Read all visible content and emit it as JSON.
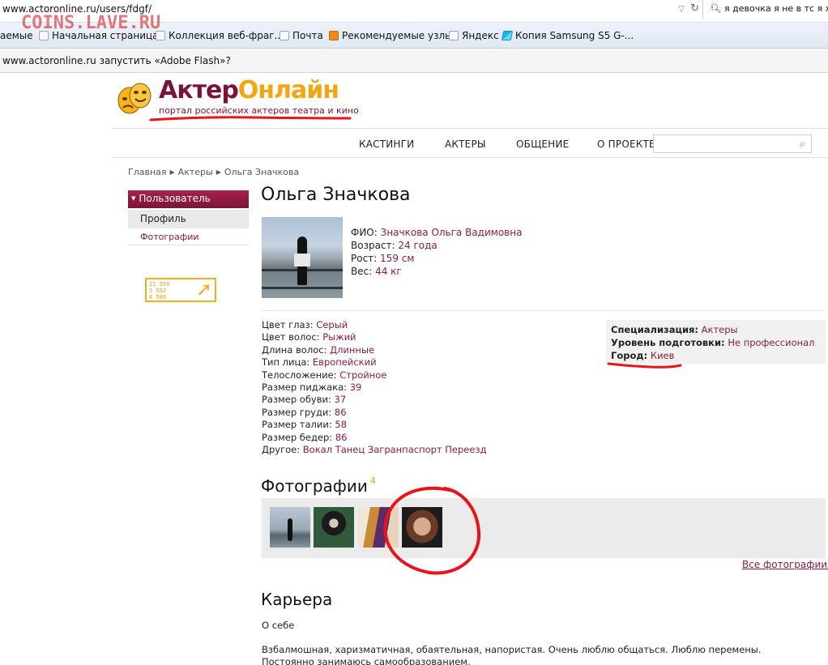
{
  "browser": {
    "url": "www.actoronline.ru/users/fdgf/",
    "search_value": "я девочка я не в тс я хочу",
    "bookmarks": [
      "аемые",
      "Начальная страница",
      "Коллекция веб-фраг...",
      "Почта",
      "Рекомендуемые узлы",
      "Яндекс",
      "Копия Samsung S5 G-..."
    ],
    "notification": "www.actoronline.ru запустить «Adobe Flash»?"
  },
  "watermark": "COINS.LAVE.RU",
  "site": {
    "brand_part1": "Актер",
    "brand_part2": "Онлайн",
    "tagline": "портал российских актеров театра и кино",
    "nav": [
      "КАСТИНГИ",
      "АКТЕРЫ",
      "ОБЩЕНИЕ",
      "О ПРОЕКТЕ"
    ],
    "breadcrumb": [
      "Главная",
      "Актеры",
      "Ольга Значкова"
    ]
  },
  "sidebar": {
    "header": "Пользователь",
    "items": [
      "Профиль",
      "Фотографии"
    ],
    "counter_lines": [
      "21 559",
      "5 552",
      "4 580"
    ]
  },
  "profile": {
    "name": "Ольга Значкова",
    "basic": [
      {
        "k": "ФИО:",
        "v": "Значкова Ольга Вадимовна"
      },
      {
        "k": "Возраст:",
        "v": "24 года"
      },
      {
        "k": "Рост:",
        "v": "159 см"
      },
      {
        "k": "Вес:",
        "v": "44 кг"
      }
    ],
    "attributes": [
      {
        "k": "Цвет глаз:",
        "v": "Серый"
      },
      {
        "k": "Цвет волос:",
        "v": "Рыжий"
      },
      {
        "k": "Длина волос:",
        "v": "Длинные"
      },
      {
        "k": "Тип лица:",
        "v": "Европейский"
      },
      {
        "k": "Телосложение:",
        "v": "Стройное"
      },
      {
        "k": "Размер пиджака:",
        "v": "39"
      },
      {
        "k": "Размер обуви:",
        "v": "37"
      },
      {
        "k": "Размер груди:",
        "v": "86"
      },
      {
        "k": "Размер талии:",
        "v": "58"
      },
      {
        "k": "Размер бедер:",
        "v": "86"
      },
      {
        "k": "Другое:",
        "v": "Вокал Танец Загранпаспорт Переезд"
      }
    ],
    "spec": [
      {
        "k": "Специализация:",
        "v": "Актеры"
      },
      {
        "k": "Уровень подготовки:",
        "v": "Не профессионал"
      },
      {
        "k": "Город:",
        "v": "Киев"
      }
    ],
    "photos_title": "Фотографии",
    "photos_count": "4",
    "all_photos": "Все фотографии »",
    "career_title": "Карьера",
    "about_label": "О себе",
    "about_text": "Взбалмошная, харизматичная, обаятельная, напористая. Очень люблю общаться. Люблю перемены. Постоянно занимаюсь самообразованием."
  }
}
